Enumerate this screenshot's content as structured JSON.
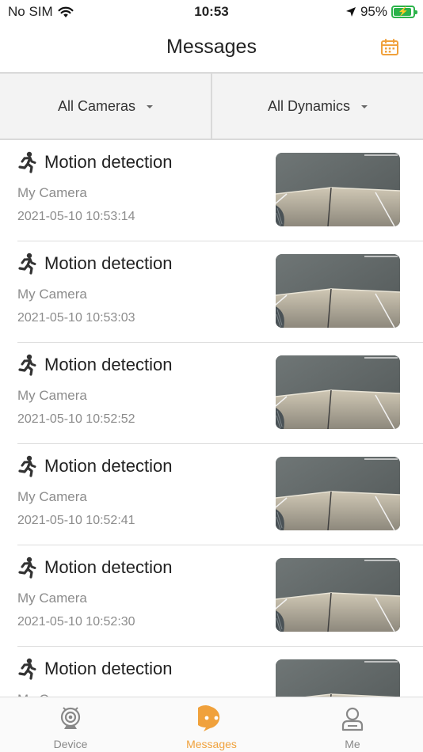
{
  "status_bar": {
    "carrier": "No SIM",
    "time": "10:53",
    "battery_percent": "95%",
    "icons": [
      "wifi-icon",
      "location-arrow-icon",
      "battery-charging-icon"
    ]
  },
  "header": {
    "title": "Messages",
    "calendar_icon": "calendar-icon"
  },
  "filters": {
    "cameras_label": "All Cameras",
    "dynamics_label": "All Dynamics"
  },
  "messages": [
    {
      "title": "Motion detection",
      "camera": "My Camera",
      "timestamp": "2021-05-10 10:53:14"
    },
    {
      "title": "Motion detection",
      "camera": "My Camera",
      "timestamp": "2021-05-10 10:53:03"
    },
    {
      "title": "Motion detection",
      "camera": "My Camera",
      "timestamp": "2021-05-10 10:52:52"
    },
    {
      "title": "Motion detection",
      "camera": "My Camera",
      "timestamp": "2021-05-10 10:52:41"
    },
    {
      "title": "Motion detection",
      "camera": "My Camera",
      "timestamp": "2021-05-10 10:52:30"
    },
    {
      "title": "Motion detection",
      "camera": "My Camera",
      "timestamp": ""
    }
  ],
  "tabs": [
    {
      "label": "Device",
      "icon": "webcam-icon",
      "active": false
    },
    {
      "label": "Messages",
      "icon": "chat-bubble-icon",
      "active": true
    },
    {
      "label": "Me",
      "icon": "person-icon",
      "active": false
    }
  ],
  "colors": {
    "accent": "#f0a13c",
    "battery": "#2bb34a",
    "secondary_text": "#8c8c8c",
    "filter_background": "#f3f3f3"
  }
}
